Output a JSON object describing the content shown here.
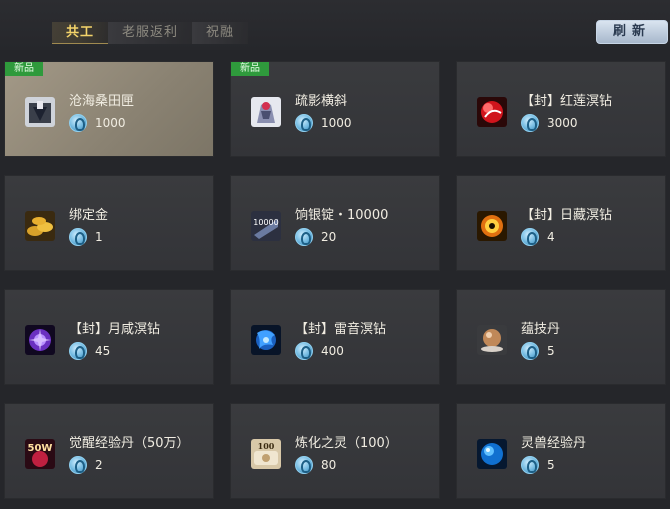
{
  "tabs": [
    {
      "label": "共工",
      "active": true
    },
    {
      "label": "老服返利",
      "active": false
    },
    {
      "label": "祝融",
      "active": false
    }
  ],
  "refresh_label": "刷新",
  "items": [
    {
      "name": "沧海桑田匣",
      "price": "1000",
      "badge": "新品",
      "icon": "chest-icon"
    },
    {
      "name": "疏影横斜",
      "price": "1000",
      "badge": "新品",
      "icon": "costume-icon"
    },
    {
      "name": "【封】红莲溟钻",
      "price": "3000",
      "badge": "",
      "icon": "red-gem-icon"
    },
    {
      "name": "绑定金",
      "price": "1",
      "badge": "",
      "icon": "gold-coins-icon"
    },
    {
      "name": "饷银锭・10000",
      "price": "20",
      "badge": "",
      "icon": "silver-ingot-icon"
    },
    {
      "name": "【封】日藏溟钻",
      "price": "4",
      "badge": "",
      "icon": "sun-gem-icon"
    },
    {
      "name": "【封】月咸溟钻",
      "price": "45",
      "badge": "",
      "icon": "moon-gem-icon"
    },
    {
      "name": "【封】雷音溟钻",
      "price": "400",
      "badge": "",
      "icon": "thunder-gem-icon"
    },
    {
      "name": "蕴技丹",
      "price": "5",
      "badge": "",
      "icon": "pill-icon"
    },
    {
      "name": "觉醒经验丹（50万）",
      "price": "2",
      "badge": "",
      "icon": "exp-pill-icon"
    },
    {
      "name": "炼化之灵（100）",
      "price": "80",
      "badge": "",
      "icon": "refine-spirit-icon"
    },
    {
      "name": "灵兽经验丹",
      "price": "5",
      "badge": "",
      "icon": "beast-exp-icon"
    }
  ],
  "selected_index": 0,
  "icon_text": {
    "ingot": "10000",
    "exp": "50W",
    "spirit": "100"
  },
  "colors": {
    "tab_active": "#f3d36a",
    "badge": "#2f9a3c",
    "currency": "#6eb7df"
  }
}
